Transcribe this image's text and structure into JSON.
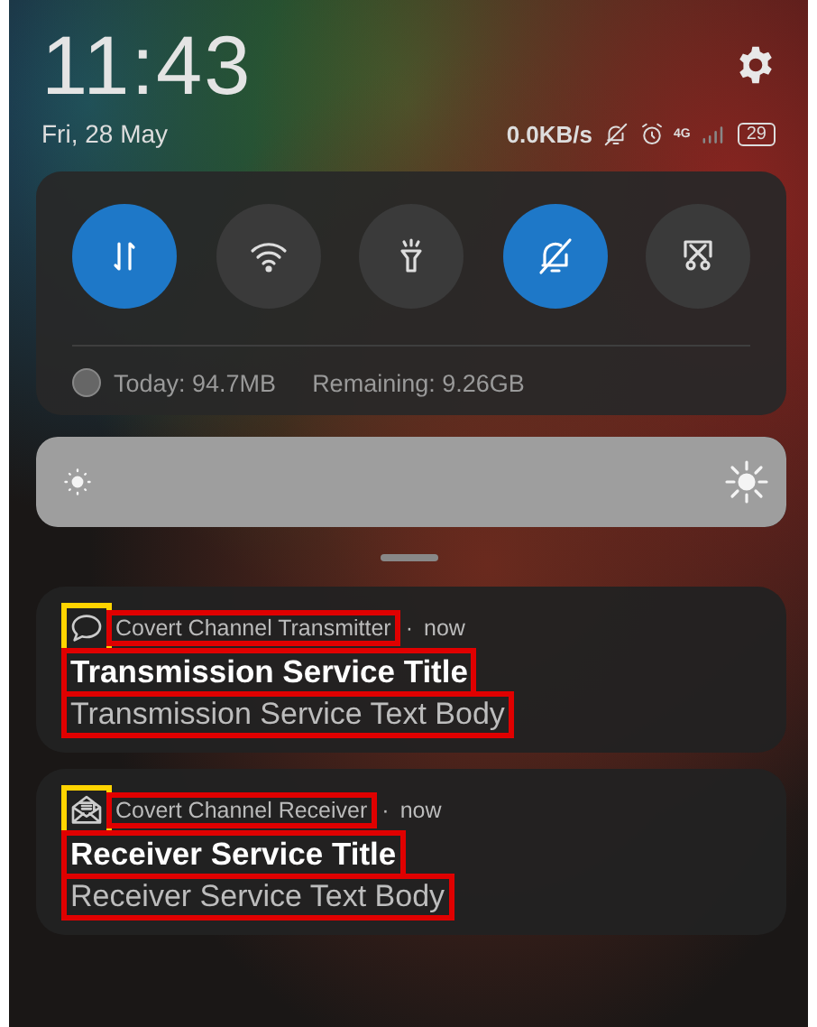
{
  "header": {
    "time": "11:43",
    "date": "Fri, 28 May",
    "net_speed": "0.0KB/s",
    "network_type": "4G",
    "battery": "29"
  },
  "tiles": [
    {
      "kind": "data",
      "on": true
    },
    {
      "kind": "wifi",
      "on": false
    },
    {
      "kind": "torch",
      "on": false
    },
    {
      "kind": "mute",
      "on": true
    },
    {
      "kind": "screenshot",
      "on": false
    }
  ],
  "brightness": {
    "level": 1.0
  },
  "data_usage": {
    "today": "Today: 94.7MB",
    "remaining": "Remaining: 9.26GB"
  },
  "notifications": [
    {
      "kind": "chat",
      "app": "Covert Channel Transmitter",
      "separator": "·",
      "time": "now",
      "title": "Transmission Service Title",
      "body": "Transmission Service Text Body",
      "highlighted": true
    },
    {
      "kind": "mail",
      "app": "Covert Channel Receiver",
      "separator": "·",
      "time": "now",
      "title": "Receiver Service Title",
      "body": "Receiver Service Text Body",
      "highlighted": true
    }
  ]
}
